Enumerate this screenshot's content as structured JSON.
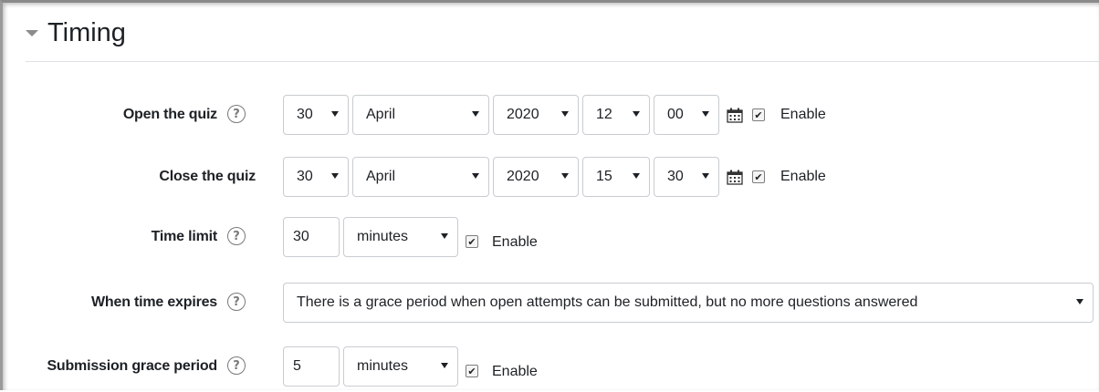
{
  "section": {
    "title": "Timing"
  },
  "open_quiz": {
    "label": "Open the quiz",
    "day": "30",
    "month": "April",
    "year": "2020",
    "hour": "12",
    "minute": "00",
    "enable_label": "Enable",
    "enabled": true
  },
  "close_quiz": {
    "label": "Close the quiz",
    "day": "30",
    "month": "April",
    "year": "2020",
    "hour": "15",
    "minute": "30",
    "enable_label": "Enable",
    "enabled": true
  },
  "time_limit": {
    "label": "Time limit",
    "value": "30",
    "unit": "minutes",
    "enable_label": "Enable",
    "enabled": true
  },
  "when_time_expires": {
    "label": "When time expires",
    "value": "There is a grace period when open attempts can be submitted, but no more questions answered"
  },
  "grace_period": {
    "label": "Submission grace period",
    "value": "5",
    "unit": "minutes",
    "enable_label": "Enable",
    "enabled": true
  },
  "icons": {
    "help": "help-icon",
    "calendar": "calendar-icon",
    "collapse": "caret-down-icon"
  }
}
